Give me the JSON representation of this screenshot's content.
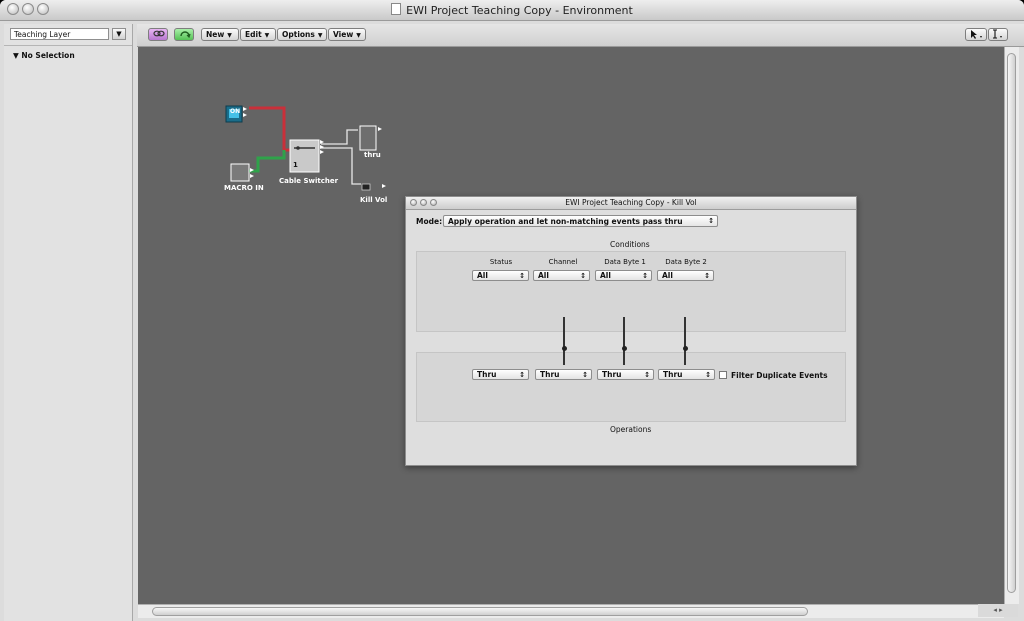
{
  "window": {
    "title": "EWI Project Teaching Copy - Environment"
  },
  "sidebar": {
    "layer": "Teaching Layer",
    "layer_arrow": "▼",
    "selection": "▼ No Selection"
  },
  "toolbar": {
    "menus": [
      "New",
      "Edit",
      "Options",
      "View"
    ],
    "menu_arrow": "▼"
  },
  "canvas": {
    "objects": {
      "macro_in": "MACRO IN",
      "cable_switcher": "Cable Switcher",
      "cable_switcher_value": "1",
      "thru": "thru",
      "kill_vol": "Kill Vol",
      "on_badge": "ON"
    },
    "cable_colors": {
      "red": "#c9303a",
      "green": "#2fa24a",
      "white": "#e8e8e8"
    }
  },
  "dialog": {
    "title": "EWI Project Teaching Copy - Kill Vol",
    "mode_label": "Mode:",
    "mode_value": "Apply operation and let non-matching events pass thru",
    "conditions_title": "Conditions",
    "operations_title": "Operations",
    "columns": [
      "Status",
      "Channel",
      "Data Byte 1",
      "Data Byte 2"
    ],
    "conditions": [
      "All",
      "All",
      "All",
      "All"
    ],
    "operations": [
      "Thru",
      "Thru",
      "Thru",
      "Thru"
    ],
    "filter_label": "Filter Duplicate Events",
    "updown": "↕"
  },
  "scroll": {
    "corner": "◂ ▸"
  }
}
